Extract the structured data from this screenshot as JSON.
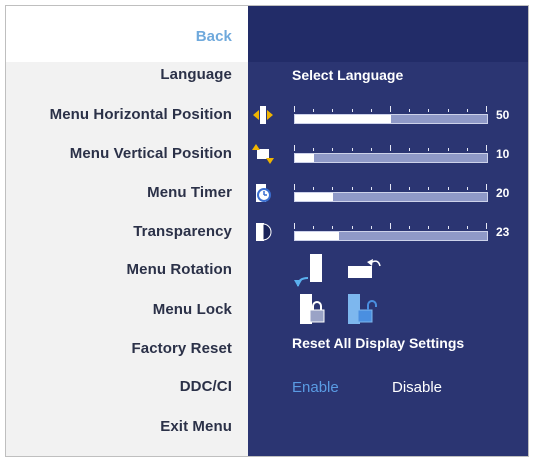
{
  "menu": {
    "back": "Back",
    "items": [
      {
        "label": "Language"
      },
      {
        "label": "Menu Horizontal Position"
      },
      {
        "label": "Menu Vertical Position"
      },
      {
        "label": "Menu Timer"
      },
      {
        "label": "Transparency"
      },
      {
        "label": "Menu Rotation"
      },
      {
        "label": "Menu Lock"
      },
      {
        "label": "Factory Reset"
      },
      {
        "label": "DDC/CI"
      },
      {
        "label": "Exit Menu"
      }
    ]
  },
  "settings": {
    "language_value": "Select Language",
    "sliders": [
      {
        "name": "menu-horizontal-position",
        "value": 50,
        "value_label": "50",
        "icon": "horizontal-arrows-icon"
      },
      {
        "name": "menu-vertical-position",
        "value": 10,
        "value_label": "10",
        "icon": "vertical-arrows-icon"
      },
      {
        "name": "menu-timer",
        "value": 20,
        "value_label": "20",
        "icon": "clock-icon"
      },
      {
        "name": "transparency",
        "value": 23,
        "value_label": "23",
        "icon": "half-circle-icon"
      }
    ],
    "rotation_icons": [
      "rotate-portrait-icon",
      "rotate-landscape-icon"
    ],
    "lock_icons": [
      "lock-icon",
      "unlock-icon"
    ],
    "factory_reset": "Reset All Display Settings",
    "ddc_ci": {
      "enable": "Enable",
      "disable": "Disable",
      "selected": "Enable"
    }
  },
  "colors": {
    "panel_bg": "#2b3572",
    "enable_highlight": "#5a9be3",
    "back_text": "#6fa9dc"
  }
}
